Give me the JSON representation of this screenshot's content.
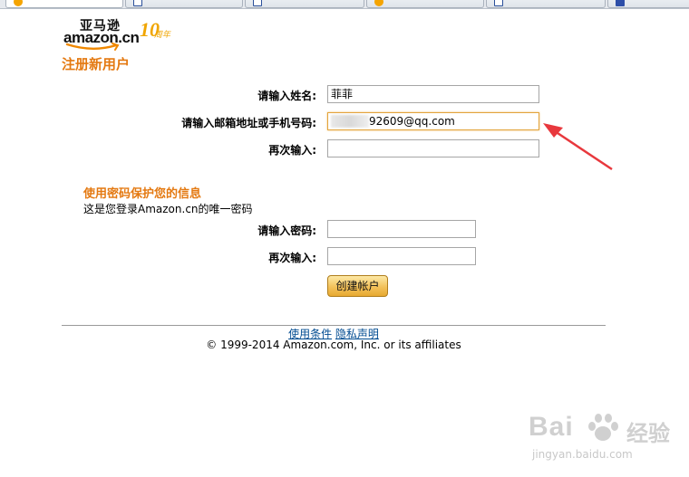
{
  "logo": {
    "cn_text": "亚马逊",
    "wordmark": "amazon.cn",
    "anniversary_num": "10",
    "anniversary_sub": "周年"
  },
  "page_title": "注册新用户",
  "form": {
    "name_label": "请输入姓名:",
    "name_value": "菲菲",
    "email_label": "请输入邮箱地址或手机号码:",
    "email_value": "92609@qq.com",
    "email_repeat_label": "再次输入:",
    "email_repeat_value": ""
  },
  "password_section": {
    "heading": "使用密码保护您的信息",
    "subtext": "这是您登录Amazon.cn的唯一密码",
    "password_label": "请输入密码:",
    "password_repeat_label": "再次输入:",
    "submit_label": "创建帐户"
  },
  "footer": {
    "terms_link": "使用条件",
    "privacy_link": "隐私声明",
    "copyright": "© 1999-2014 Amazon.com, Inc. or its affiliates"
  },
  "watermark": {
    "main": "Bai",
    "cn": "经验",
    "url": "jingyan.baidu.com"
  },
  "colors": {
    "accent": "#e47911",
    "link": "#004b91",
    "annotation_arrow": "#e8383d"
  },
  "icons": [
    "amazon-smile-logo",
    "annotation-arrow",
    "baidu-paw-icon"
  ]
}
